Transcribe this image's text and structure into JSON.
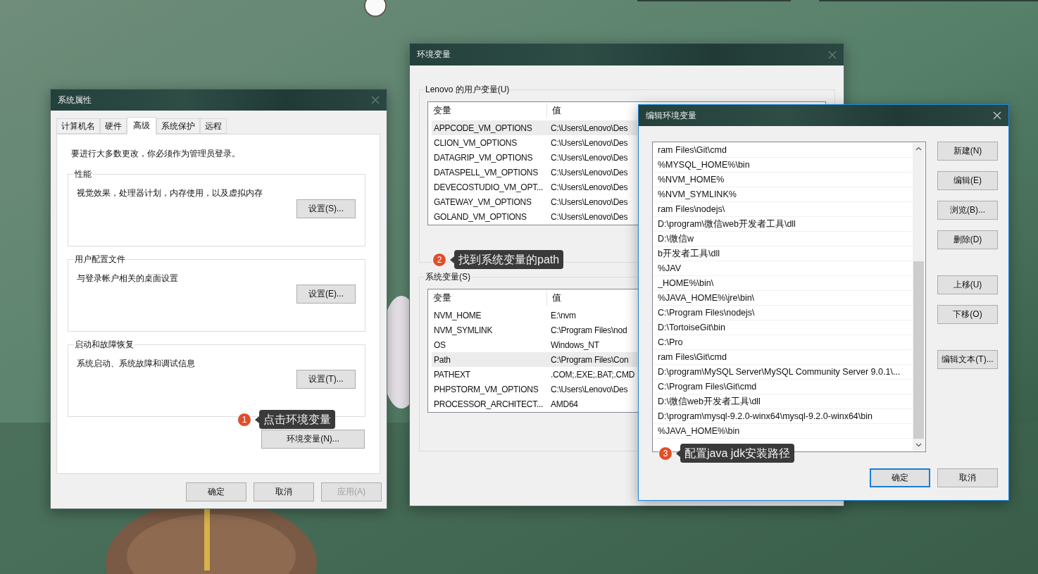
{
  "system_properties": {
    "title": "系统属性",
    "tabs": [
      {
        "label": "计算机名",
        "selected": false
      },
      {
        "label": "硬件",
        "selected": false
      },
      {
        "label": "高级",
        "selected": true
      },
      {
        "label": "系统保护",
        "selected": false
      },
      {
        "label": "远程",
        "selected": false
      }
    ],
    "notice": "要进行大多数更改，你必须作为管理员登录。",
    "groups": [
      {
        "title": "性能",
        "description": "视觉效果，处理器计划，内存使用，以及虚拟内存",
        "button": "设置(S)..."
      },
      {
        "title": "用户配置文件",
        "description": "与登录帐户相关的桌面设置",
        "button": "设置(E)..."
      },
      {
        "title": "启动和故障恢复",
        "description": "系统启动、系统故障和调试信息",
        "button": "设置(T)..."
      }
    ],
    "env_button": "环境变量(N)...",
    "buttons": [
      {
        "label": "确定",
        "disabled": false
      },
      {
        "label": "取消",
        "disabled": false
      },
      {
        "label": "应用(A)",
        "disabled": true
      }
    ]
  },
  "environment_variables": {
    "title": "环境变量",
    "sections": [
      {
        "title": "Lenovo 的用户变量(U)",
        "columns": [
          "变量",
          "值"
        ],
        "rows": [
          {
            "name": "APPCODE_VM_OPTIONS",
            "value": "C:\\Users\\Lenovo\\Des",
            "selected": true
          },
          {
            "name": "CLION_VM_OPTIONS",
            "value": "C:\\Users\\Lenovo\\Des",
            "selected": false
          },
          {
            "name": "DATAGRIP_VM_OPTIONS",
            "value": "C:\\Users\\Lenovo\\Des",
            "selected": false
          },
          {
            "name": "DATASPELL_VM_OPTIONS",
            "value": "C:\\Users\\Lenovo\\Des",
            "selected": false
          },
          {
            "name": "DEVECOSTUDIO_VM_OPT...",
            "value": "C:\\Users\\Lenovo\\Des",
            "selected": false
          },
          {
            "name": "GATEWAY_VM_OPTIONS",
            "value": "C:\\Users\\Lenovo\\Des",
            "selected": false
          },
          {
            "name": "GOLAND_VM_OPTIONS",
            "value": "C:\\Users\\Lenovo\\Des",
            "selected": false
          }
        ]
      },
      {
        "title": "系统变量(S)",
        "columns": [
          "变量",
          "值"
        ],
        "rows": [
          {
            "name": "NVM_HOME",
            "value": "E:\\nvm",
            "selected": false
          },
          {
            "name": "NVM_SYMLINK",
            "value": "C:\\Program Files\\nod",
            "selected": false
          },
          {
            "name": "OS",
            "value": "Windows_NT",
            "selected": false
          },
          {
            "name": "Path",
            "value": "C:\\Program Files\\Con",
            "selected": true
          },
          {
            "name": "PATHEXT",
            "value": ".COM;.EXE;.BAT;.CMD",
            "selected": false
          },
          {
            "name": "PHPSTORM_VM_OPTIONS",
            "value": "C:\\Users\\Lenovo\\Des",
            "selected": false
          },
          {
            "name": "PROCESSOR_ARCHITECT...",
            "value": "AMD64",
            "selected": false
          }
        ]
      }
    ]
  },
  "edit_environment_variable": {
    "title": "编辑环境变量",
    "entries": [
      "ram Files\\Git\\cmd",
      "%MYSQL_HOME%\\bin",
      "%NVM_HOME%",
      "%NVM_SYMLINK%",
      "ram Files\\nodejs\\",
      "D:\\program\\微信web开发者工具\\dll",
      "D:\\微信w",
      "b开发者工具\\dll",
      "%JAV",
      "_HOME%\\bin\\",
      "%JAVA_HOME%\\jre\\bin\\",
      "C:\\Program Files\\nodejs\\",
      "D:\\TortoiseGit\\bin",
      "C:\\Pro",
      "ram Files\\Git\\cmd",
      "D:\\program\\MySQL Server\\MySQL Community Server 9.0.1\\...",
      "C:\\Program Files\\Git\\cmd",
      "D:\\微信web开发者工具\\dll",
      "D:\\program\\mysql-9.2.0-winx64\\mysql-9.2.0-winx64\\bin",
      "%JAVA_HOME%\\bin"
    ],
    "side_buttons": [
      "新建(N)",
      "编辑(E)",
      "浏览(B)...",
      "删除(D)",
      "上移(U)",
      "下移(O)",
      "编辑文本(T)..."
    ],
    "buttons": [
      {
        "label": "确定",
        "default": true
      },
      {
        "label": "取消",
        "default": false
      }
    ]
  },
  "annotations": [
    {
      "number": "1",
      "text": "点击环境变量"
    },
    {
      "number": "2",
      "text": "找到系统变量的path"
    },
    {
      "number": "3",
      "text": "配置java jdk安装路径"
    }
  ]
}
